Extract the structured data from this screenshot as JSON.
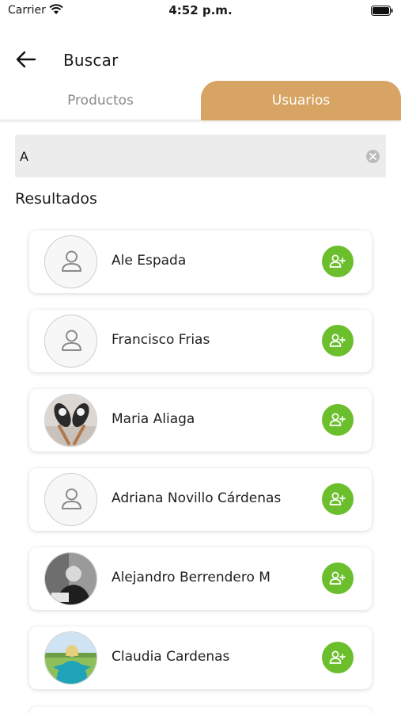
{
  "status_bar": {
    "carrier": "Carrier",
    "time": "4:52 p.m."
  },
  "header": {
    "title": "Buscar",
    "back_icon": "arrow-left-icon"
  },
  "tabs": [
    {
      "label": "Productos",
      "active": false
    },
    {
      "label": "Usuarios",
      "active": true
    }
  ],
  "search": {
    "value": "A",
    "clear_icon": "clear-circle-icon"
  },
  "results": {
    "heading": "Resultados",
    "users": [
      {
        "name": "Ale Espada",
        "avatar": "placeholder-user-icon"
      },
      {
        "name": "Francisco Frias",
        "avatar": "placeholder-user-icon"
      },
      {
        "name": "Maria Aliaga",
        "avatar": "photo"
      },
      {
        "name": "Adriana Novillo Cárdenas",
        "avatar": "placeholder-user-icon"
      },
      {
        "name": "Alejandro Berrendero M",
        "avatar": "photo"
      },
      {
        "name": "Claudia Cardenas",
        "avatar": "photo"
      }
    ],
    "add_icon": "add-user-icon"
  },
  "colors": {
    "accent": "#d8a463",
    "add_button": "#6cbf2c",
    "search_bg": "#ececec"
  }
}
